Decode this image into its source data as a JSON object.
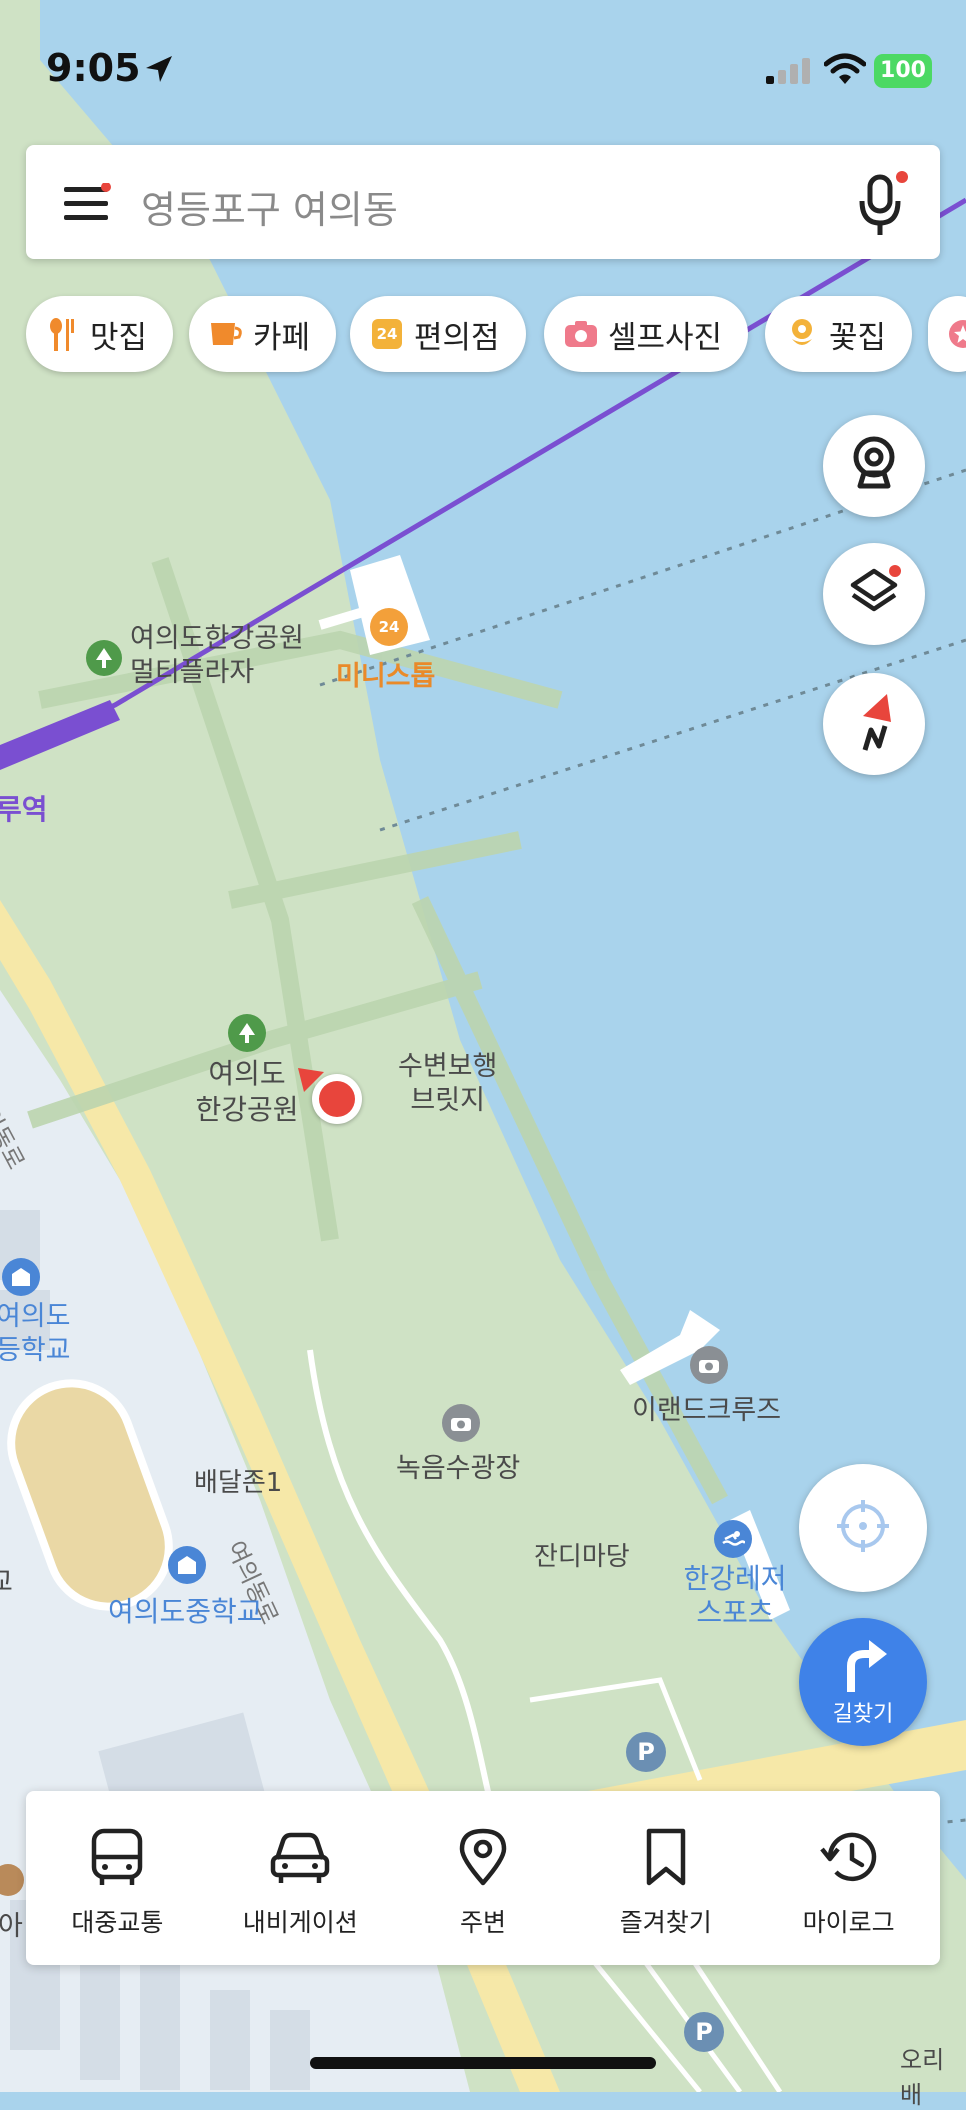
{
  "status": {
    "time": "9:05",
    "battery": "100"
  },
  "search": {
    "placeholder": "영등포구 여의동"
  },
  "chips": [
    {
      "label": "맛집",
      "icon": "restaurant-icon"
    },
    {
      "label": "카페",
      "icon": "cafe-icon"
    },
    {
      "label": "편의점",
      "icon": "convenience-store-icon",
      "badge": "24"
    },
    {
      "label": "셀프사진",
      "icon": "camera-icon"
    },
    {
      "label": "꽃집",
      "icon": "flower-icon"
    }
  ],
  "map_labels": {
    "plaza": [
      "여의도한강공원",
      "멀티플라자"
    ],
    "ministop": "미니스톱",
    "station_partial": "루역",
    "park": [
      "여의도",
      "한강공원"
    ],
    "bridge": [
      "수변보행",
      "브릿지"
    ],
    "road_left": "여의동로",
    "school_high": [
      "여의도",
      "등학교"
    ],
    "cruise": "이랜드크루즈",
    "square": "녹음수광장",
    "delivery": "배달존1",
    "road_bottom": "여의동로",
    "grass": "잔디마당",
    "leisure": [
      "한강레저",
      "스포츠"
    ],
    "school_middle": "여의도중학교",
    "bottom_right": "오리배",
    "ministop_badge": "24",
    "parking": "P",
    "left_edge_1": "아",
    "left_edge_2": "교"
  },
  "controls": {
    "route_label": "길찾기"
  },
  "bottom_nav": [
    {
      "label": "대중교통",
      "icon": "bus-icon"
    },
    {
      "label": "내비게이션",
      "icon": "car-icon"
    },
    {
      "label": "주변",
      "icon": "location-pin-icon"
    },
    {
      "label": "즐겨찾기",
      "icon": "bookmark-icon"
    },
    {
      "label": "마이로그",
      "icon": "history-icon"
    }
  ],
  "colors": {
    "water": "#a9d3ec",
    "park": "#cfe2c5",
    "park_dark": "#bcd5af",
    "subway_line": "#7a4fd1",
    "accent_red": "#e8453c",
    "route_blue": "#3f82e8"
  }
}
